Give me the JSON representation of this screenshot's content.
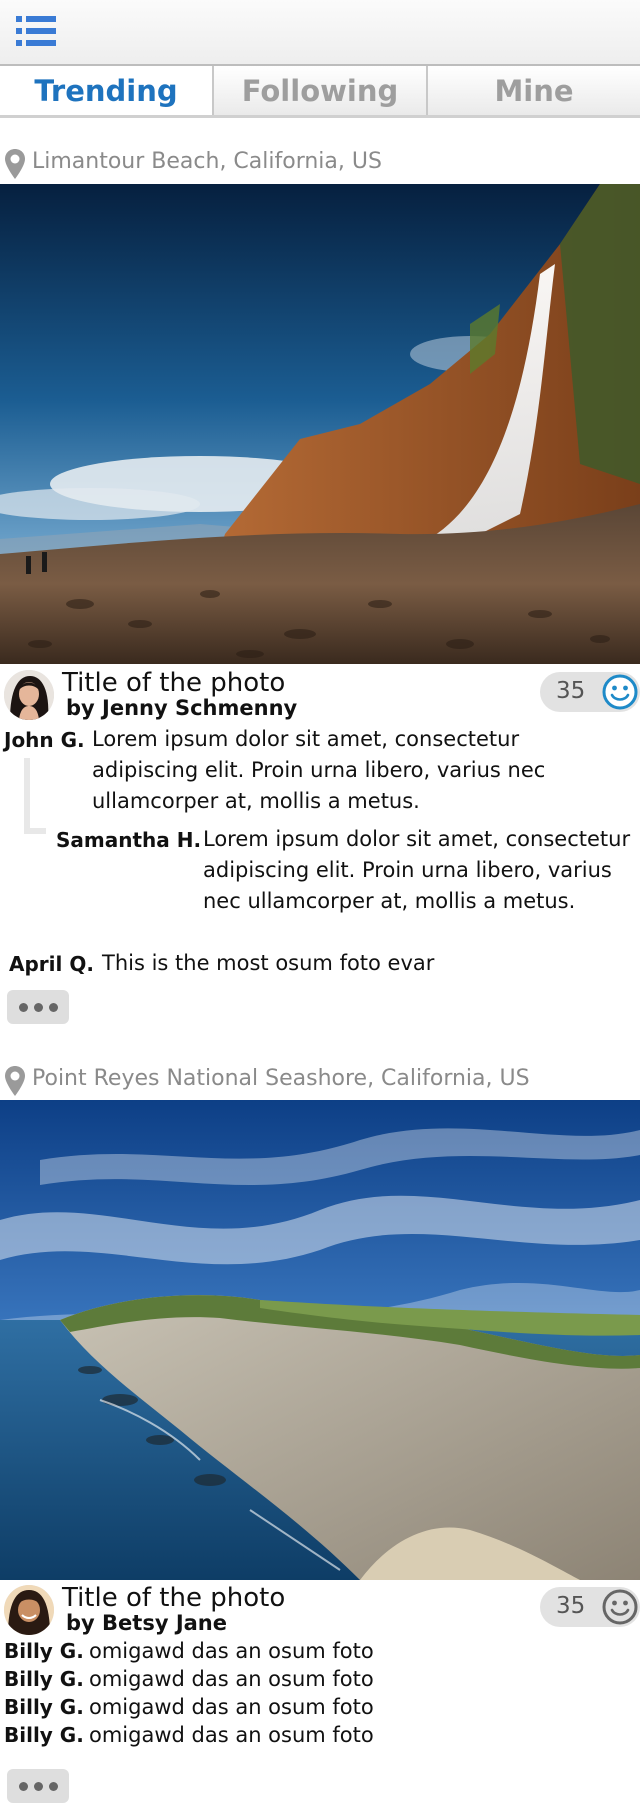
{
  "nav": {
    "menu_icon": "list-icon",
    "tabs": [
      {
        "label": "Trending",
        "active": true
      },
      {
        "label": "Following",
        "active": false
      },
      {
        "label": "Mine",
        "active": false
      }
    ]
  },
  "colors": {
    "accent": "#1e73be",
    "tab_inactive": "#9e9e9e",
    "location_text": "#8a8a8a"
  },
  "posts": [
    {
      "location": "Limantour Beach, California, US",
      "location_icon": "map-pin-icon",
      "photo_alt": "waterfall beach photo",
      "title": "Title of the photo",
      "author": "by Jenny Schmenny",
      "likes": "35",
      "like_icon": "smiley-icon",
      "like_active": true,
      "comments": [
        {
          "name": "John G.",
          "text": "Lorem ipsum dolor sit amet, consectetur adipiscing elit. Proin urna libero, varius nec ullamcorper at, mollis a metus."
        },
        {
          "name": "Samantha H.",
          "text": "Lorem ipsum dolor sit amet, consectetur adipiscing elit. Proin urna libero, varius nec ullamcorper at, mollis a metus.",
          "reply": true
        },
        {
          "name": "April Q.",
          "text": "This is the most osum foto evar"
        }
      ],
      "more_icon": "ellipsis-icon"
    },
    {
      "location": "Point Reyes National Seashore, California, US",
      "location_icon": "map-pin-icon",
      "photo_alt": "coastline cliffs photo",
      "title": "Title of the photo",
      "author": "by Betsy Jane",
      "likes": "35",
      "like_icon": "smiley-icon",
      "like_active": false,
      "comments": [
        {
          "name": "Billy G.",
          "text": "omigawd das an osum foto"
        },
        {
          "name": "Billy G.",
          "text": "omigawd das an osum foto"
        },
        {
          "name": "Billy G.",
          "text": "omigawd das an osum foto"
        },
        {
          "name": "Billy G.",
          "text": "omigawd das an osum foto"
        }
      ],
      "more_icon": "ellipsis-icon"
    }
  ]
}
